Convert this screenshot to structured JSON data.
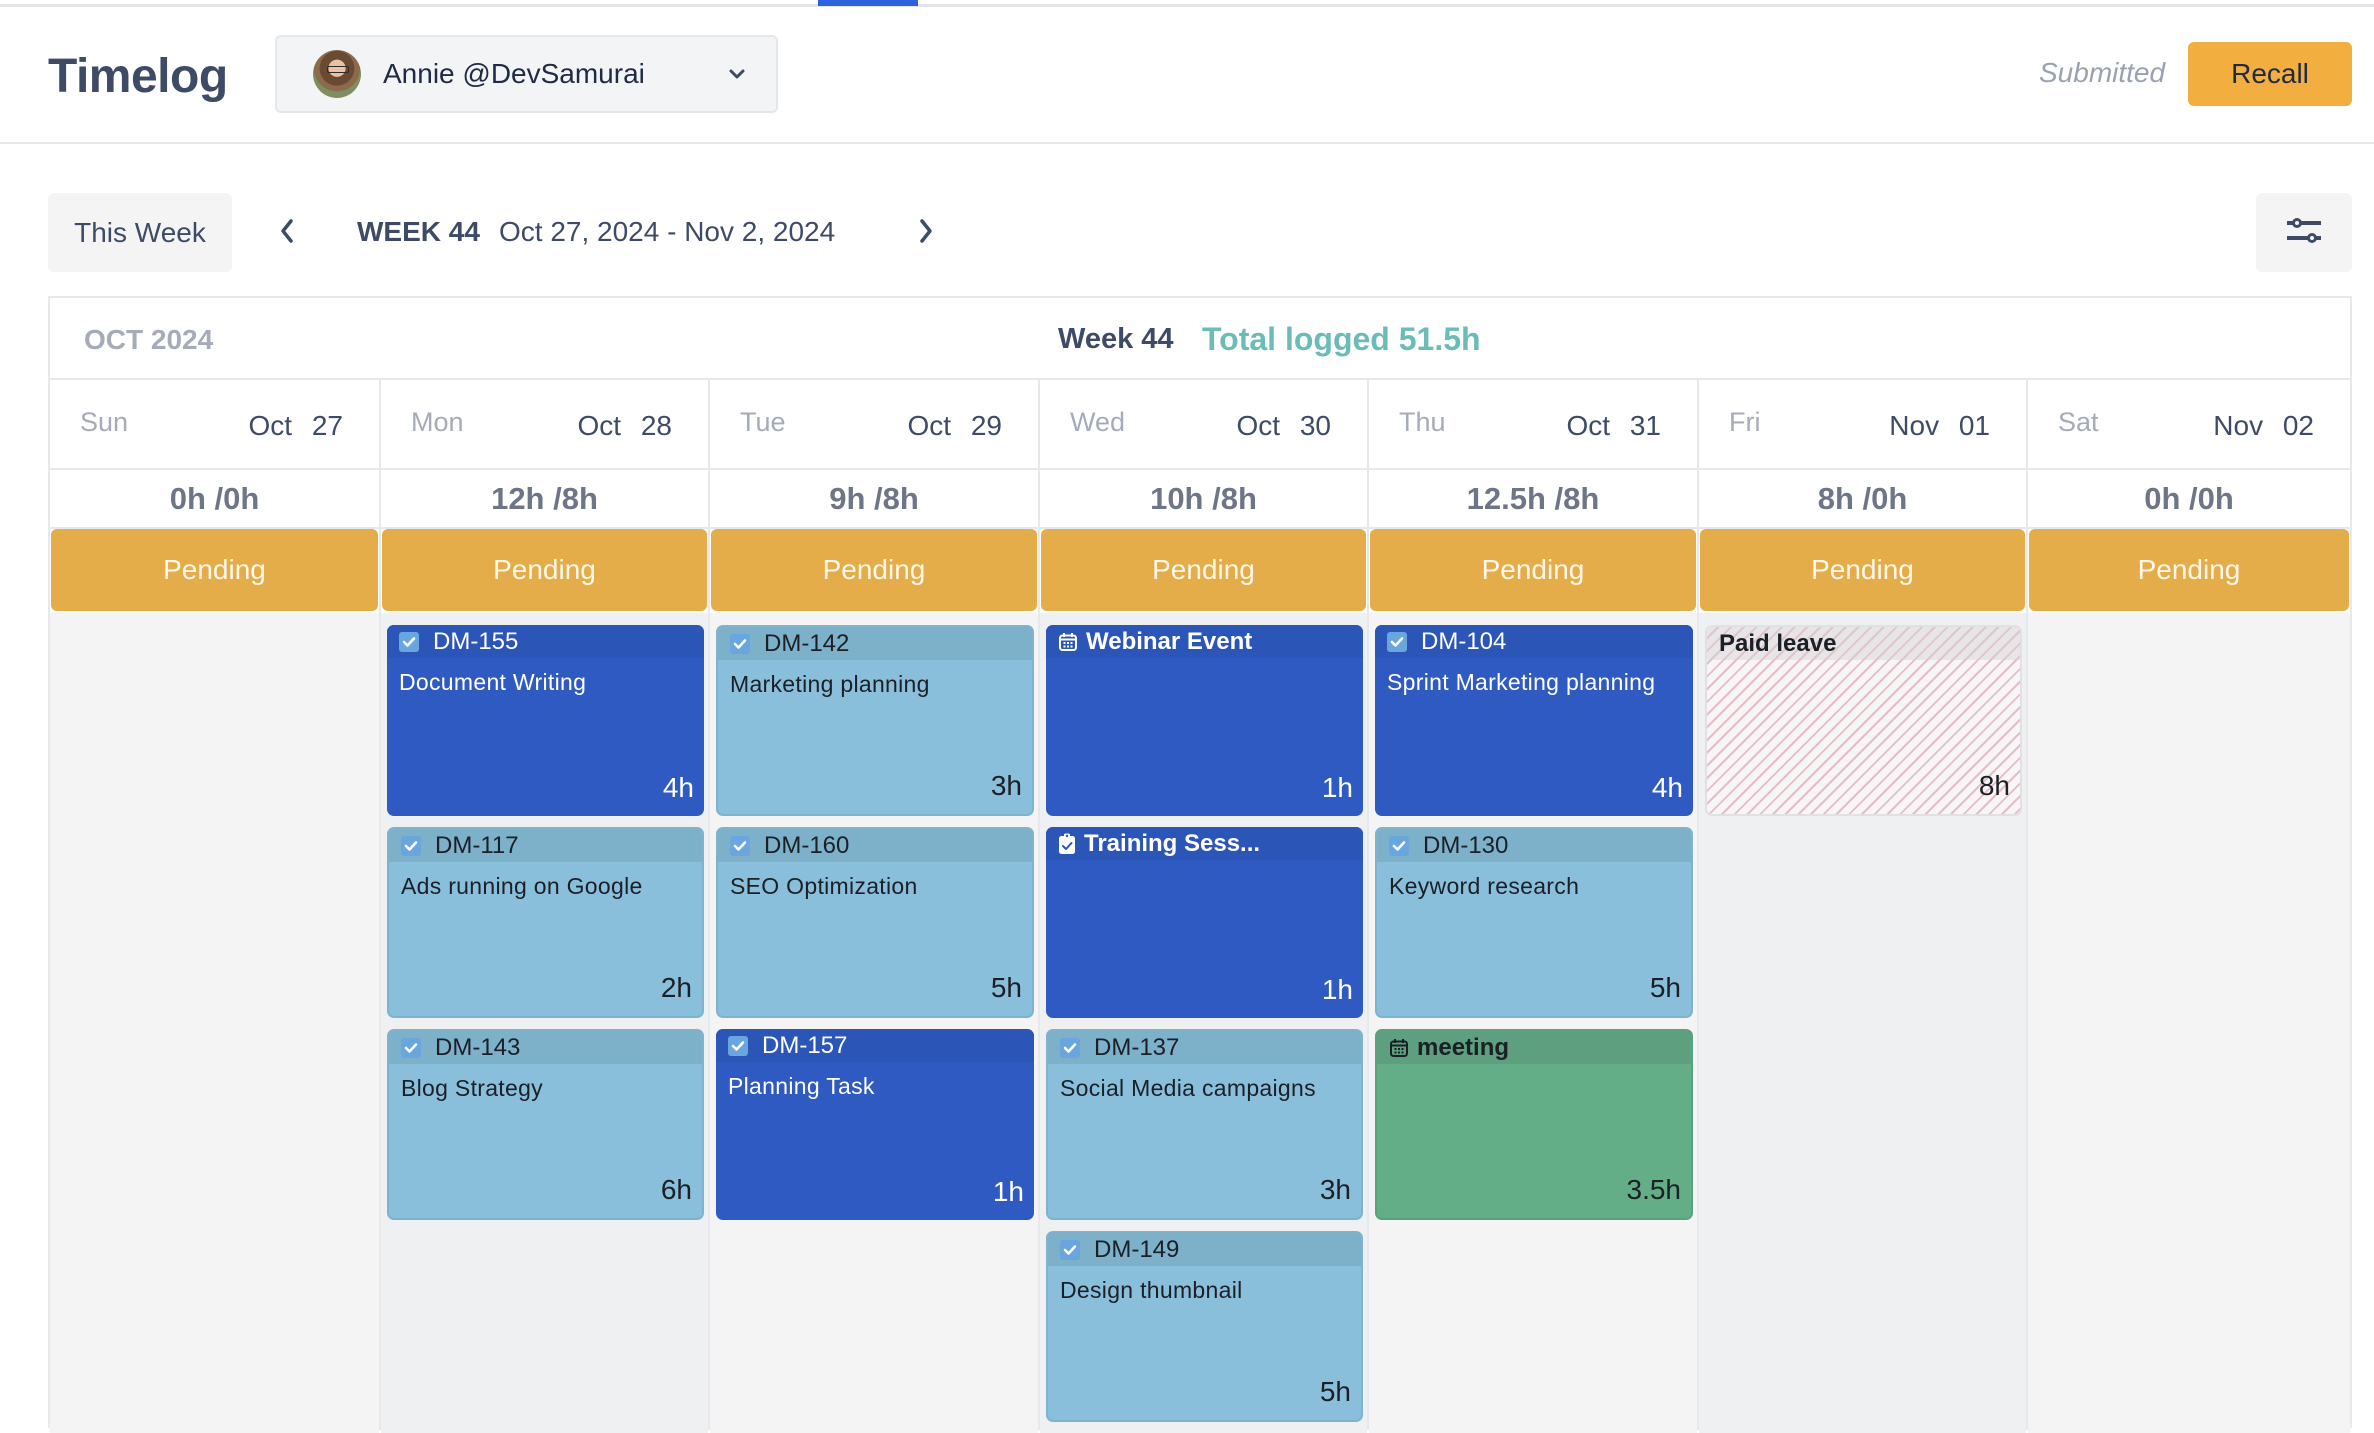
{
  "header": {
    "title": "Timelog",
    "user": {
      "name": "Annie @DevSamurai",
      "avatar": "user-avatar-photo"
    },
    "status": "Submitted",
    "recall_label": "Recall"
  },
  "toolbar": {
    "this_week_label": "This Week",
    "week_label": "WEEK 44",
    "date_range": "Oct 27, 2024 - Nov 2, 2024",
    "prev_icon": "chevron-left-icon",
    "next_icon": "chevron-right-icon",
    "filter_icon": "sliders-icon"
  },
  "calendar": {
    "month": "OCT 2024",
    "week": "Week 44",
    "total_logged": "Total logged 51.5h",
    "colors": {
      "pending": "#e5ad4a",
      "total_logged": "#6bbcb7",
      "accent": "#2d63db",
      "recall": "#f2ae3e"
    },
    "days": [
      {
        "name": "Sun",
        "date": "Oct 27",
        "hours": "0h /0h",
        "status": "Pending",
        "entries": []
      },
      {
        "name": "Mon",
        "date": "Oct 28",
        "hours": "12h /8h",
        "status": "Pending",
        "entries": [
          {
            "type": "task",
            "style": "dark",
            "key": "DM-155",
            "title": "Document Writing",
            "hours": "4h"
          },
          {
            "type": "task",
            "style": "light",
            "key": "DM-117",
            "title": "Ads running on Google",
            "hours": "2h"
          },
          {
            "type": "task",
            "style": "light",
            "key": "DM-143",
            "title": "Blog Strategy",
            "hours": "6h"
          }
        ]
      },
      {
        "name": "Tue",
        "date": "Oct 29",
        "hours": "9h /8h",
        "status": "Pending",
        "entries": [
          {
            "type": "task",
            "style": "light",
            "key": "DM-142",
            "title": "Marketing planning",
            "hours": "3h"
          },
          {
            "type": "task",
            "style": "light",
            "key": "DM-160",
            "title": "SEO Optimization",
            "hours": "5h"
          },
          {
            "type": "task",
            "style": "dark",
            "key": "DM-157",
            "title": "Planning Task",
            "hours": "1h"
          }
        ]
      },
      {
        "name": "Wed",
        "date": "Oct 30",
        "hours": "10h /8h",
        "status": "Pending",
        "entries": [
          {
            "type": "event",
            "style": "dark",
            "icon": "calendar-icon",
            "key": "Webinar Event",
            "title": "",
            "hours": "1h"
          },
          {
            "type": "event",
            "style": "dark",
            "icon": "clipboard-check-icon",
            "key": "Training Sess...",
            "title": "",
            "hours": "1h"
          },
          {
            "type": "task",
            "style": "light",
            "key": "DM-137",
            "title": "Social Media campaigns",
            "hours": "3h"
          },
          {
            "type": "task",
            "style": "light",
            "key": "DM-149",
            "title": "Design thumbnail",
            "hours": "5h"
          }
        ]
      },
      {
        "name": "Thu",
        "date": "Oct 31",
        "hours": "12.5h /8h",
        "status": "Pending",
        "entries": [
          {
            "type": "task",
            "style": "dark",
            "key": "DM-104",
            "title": "Sprint Marketing planning",
            "hours": "4h"
          },
          {
            "type": "task",
            "style": "light",
            "key": "DM-130",
            "title": "Keyword research",
            "hours": "5h"
          },
          {
            "type": "event",
            "style": "green",
            "icon": "calendar-icon",
            "key": "meeting",
            "title": "",
            "hours": "3.5h"
          }
        ]
      },
      {
        "name": "Fri",
        "date": "Nov 01",
        "hours": "8h /0h",
        "status": "Pending",
        "entries": [
          {
            "type": "leave",
            "style": "leave",
            "key": "Paid leave",
            "title": "",
            "hours": "8h"
          }
        ]
      },
      {
        "name": "Sat",
        "date": "Nov 02",
        "hours": "0h /0h",
        "status": "Pending",
        "entries": []
      }
    ]
  }
}
